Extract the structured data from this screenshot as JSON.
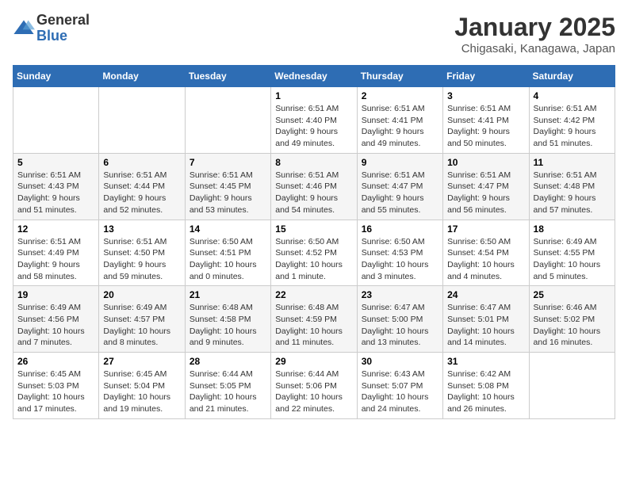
{
  "logo": {
    "general": "General",
    "blue": "Blue"
  },
  "title": "January 2025",
  "location": "Chigasaki, Kanagawa, Japan",
  "days_of_week": [
    "Sunday",
    "Monday",
    "Tuesday",
    "Wednesday",
    "Thursday",
    "Friday",
    "Saturday"
  ],
  "weeks": [
    [
      {
        "day": "",
        "info": ""
      },
      {
        "day": "",
        "info": ""
      },
      {
        "day": "",
        "info": ""
      },
      {
        "day": "1",
        "info": "Sunrise: 6:51 AM\nSunset: 4:40 PM\nDaylight: 9 hours and 49 minutes."
      },
      {
        "day": "2",
        "info": "Sunrise: 6:51 AM\nSunset: 4:41 PM\nDaylight: 9 hours and 49 minutes."
      },
      {
        "day": "3",
        "info": "Sunrise: 6:51 AM\nSunset: 4:41 PM\nDaylight: 9 hours and 50 minutes."
      },
      {
        "day": "4",
        "info": "Sunrise: 6:51 AM\nSunset: 4:42 PM\nDaylight: 9 hours and 51 minutes."
      }
    ],
    [
      {
        "day": "5",
        "info": "Sunrise: 6:51 AM\nSunset: 4:43 PM\nDaylight: 9 hours and 51 minutes."
      },
      {
        "day": "6",
        "info": "Sunrise: 6:51 AM\nSunset: 4:44 PM\nDaylight: 9 hours and 52 minutes."
      },
      {
        "day": "7",
        "info": "Sunrise: 6:51 AM\nSunset: 4:45 PM\nDaylight: 9 hours and 53 minutes."
      },
      {
        "day": "8",
        "info": "Sunrise: 6:51 AM\nSunset: 4:46 PM\nDaylight: 9 hours and 54 minutes."
      },
      {
        "day": "9",
        "info": "Sunrise: 6:51 AM\nSunset: 4:47 PM\nDaylight: 9 hours and 55 minutes."
      },
      {
        "day": "10",
        "info": "Sunrise: 6:51 AM\nSunset: 4:47 PM\nDaylight: 9 hours and 56 minutes."
      },
      {
        "day": "11",
        "info": "Sunrise: 6:51 AM\nSunset: 4:48 PM\nDaylight: 9 hours and 57 minutes."
      }
    ],
    [
      {
        "day": "12",
        "info": "Sunrise: 6:51 AM\nSunset: 4:49 PM\nDaylight: 9 hours and 58 minutes."
      },
      {
        "day": "13",
        "info": "Sunrise: 6:51 AM\nSunset: 4:50 PM\nDaylight: 9 hours and 59 minutes."
      },
      {
        "day": "14",
        "info": "Sunrise: 6:50 AM\nSunset: 4:51 PM\nDaylight: 10 hours and 0 minutes."
      },
      {
        "day": "15",
        "info": "Sunrise: 6:50 AM\nSunset: 4:52 PM\nDaylight: 10 hours and 1 minute."
      },
      {
        "day": "16",
        "info": "Sunrise: 6:50 AM\nSunset: 4:53 PM\nDaylight: 10 hours and 3 minutes."
      },
      {
        "day": "17",
        "info": "Sunrise: 6:50 AM\nSunset: 4:54 PM\nDaylight: 10 hours and 4 minutes."
      },
      {
        "day": "18",
        "info": "Sunrise: 6:49 AM\nSunset: 4:55 PM\nDaylight: 10 hours and 5 minutes."
      }
    ],
    [
      {
        "day": "19",
        "info": "Sunrise: 6:49 AM\nSunset: 4:56 PM\nDaylight: 10 hours and 7 minutes."
      },
      {
        "day": "20",
        "info": "Sunrise: 6:49 AM\nSunset: 4:57 PM\nDaylight: 10 hours and 8 minutes."
      },
      {
        "day": "21",
        "info": "Sunrise: 6:48 AM\nSunset: 4:58 PM\nDaylight: 10 hours and 9 minutes."
      },
      {
        "day": "22",
        "info": "Sunrise: 6:48 AM\nSunset: 4:59 PM\nDaylight: 10 hours and 11 minutes."
      },
      {
        "day": "23",
        "info": "Sunrise: 6:47 AM\nSunset: 5:00 PM\nDaylight: 10 hours and 13 minutes."
      },
      {
        "day": "24",
        "info": "Sunrise: 6:47 AM\nSunset: 5:01 PM\nDaylight: 10 hours and 14 minutes."
      },
      {
        "day": "25",
        "info": "Sunrise: 6:46 AM\nSunset: 5:02 PM\nDaylight: 10 hours and 16 minutes."
      }
    ],
    [
      {
        "day": "26",
        "info": "Sunrise: 6:45 AM\nSunset: 5:03 PM\nDaylight: 10 hours and 17 minutes."
      },
      {
        "day": "27",
        "info": "Sunrise: 6:45 AM\nSunset: 5:04 PM\nDaylight: 10 hours and 19 minutes."
      },
      {
        "day": "28",
        "info": "Sunrise: 6:44 AM\nSunset: 5:05 PM\nDaylight: 10 hours and 21 minutes."
      },
      {
        "day": "29",
        "info": "Sunrise: 6:44 AM\nSunset: 5:06 PM\nDaylight: 10 hours and 22 minutes."
      },
      {
        "day": "30",
        "info": "Sunrise: 6:43 AM\nSunset: 5:07 PM\nDaylight: 10 hours and 24 minutes."
      },
      {
        "day": "31",
        "info": "Sunrise: 6:42 AM\nSunset: 5:08 PM\nDaylight: 10 hours and 26 minutes."
      },
      {
        "day": "",
        "info": ""
      }
    ]
  ]
}
